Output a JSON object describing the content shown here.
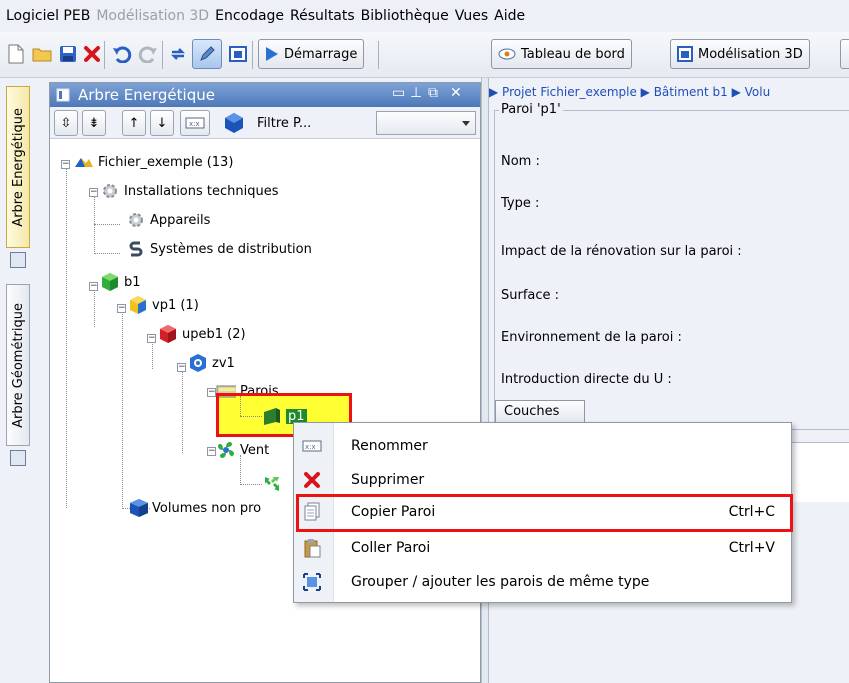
{
  "menubar": {
    "items": [
      {
        "label": "Logiciel PEB",
        "enabled": true
      },
      {
        "label": "Modélisation 3D",
        "enabled": false
      },
      {
        "label": "Encodage",
        "enabled": true
      },
      {
        "label": "Résultats",
        "enabled": true
      },
      {
        "label": "Bibliothèque",
        "enabled": true
      },
      {
        "label": "Vues",
        "enabled": true
      },
      {
        "label": "Aide",
        "enabled": true
      }
    ]
  },
  "toolbar": {
    "start_label": "Démarrage",
    "dashboard_label": "Tableau de bord",
    "modelling_label": "Modélisation 3D"
  },
  "side_tabs": {
    "energy_tree": "Arbre Energétique",
    "geometry_tree": "Arbre Géométrique"
  },
  "panel": {
    "title": "Arbre Energétique",
    "filter_label": "Filtre P...",
    "filter_value": ""
  },
  "tree": {
    "root": "Fichier_exemple (13)",
    "installations": "Installations techniques",
    "appareils": "Appareils",
    "distribution": "Systèmes de distribution",
    "b1": "b1",
    "vp1": "vp1 (1)",
    "upeb1": "upeb1 (2)",
    "zv1": "zv1",
    "parois": "Parois",
    "p1": "p1",
    "ventilation": "Vent",
    "volumes": "Volumes non pro"
  },
  "detail": {
    "breadcrumb": "▶ Projet Fichier_exemple ▶ Bâtiment b1 ▶ Volu",
    "group_title": "Paroi 'p1'",
    "fields": {
      "nom": "Nom :",
      "type": "Type :",
      "impact": "Impact de la rénovation sur la paroi :",
      "surface": "Surface :",
      "environnement": "Environnement de la paroi :",
      "u": "Introduction directe du U :"
    },
    "couches_label": "Couches"
  },
  "context_menu": {
    "items": [
      {
        "label": "Renommer",
        "shortcut": "",
        "icon": "rename-icon"
      },
      {
        "label": "Supprimer",
        "shortcut": "",
        "icon": "delete-icon"
      },
      {
        "label": "Copier Paroi",
        "shortcut": "Ctrl+C",
        "icon": "copy-icon",
        "highlighted": true
      },
      {
        "label": "Coller Paroi",
        "shortcut": "Ctrl+V",
        "icon": "paste-icon"
      },
      {
        "label": "Grouper / ajouter les parois de même type",
        "shortcut": "",
        "icon": "group-icon"
      }
    ]
  },
  "colors": {
    "highlight_yellow": "#ffff33",
    "annotation_red": "#ee1111",
    "panel_title": "#4d78b8",
    "delete_red": "#d8141a"
  }
}
